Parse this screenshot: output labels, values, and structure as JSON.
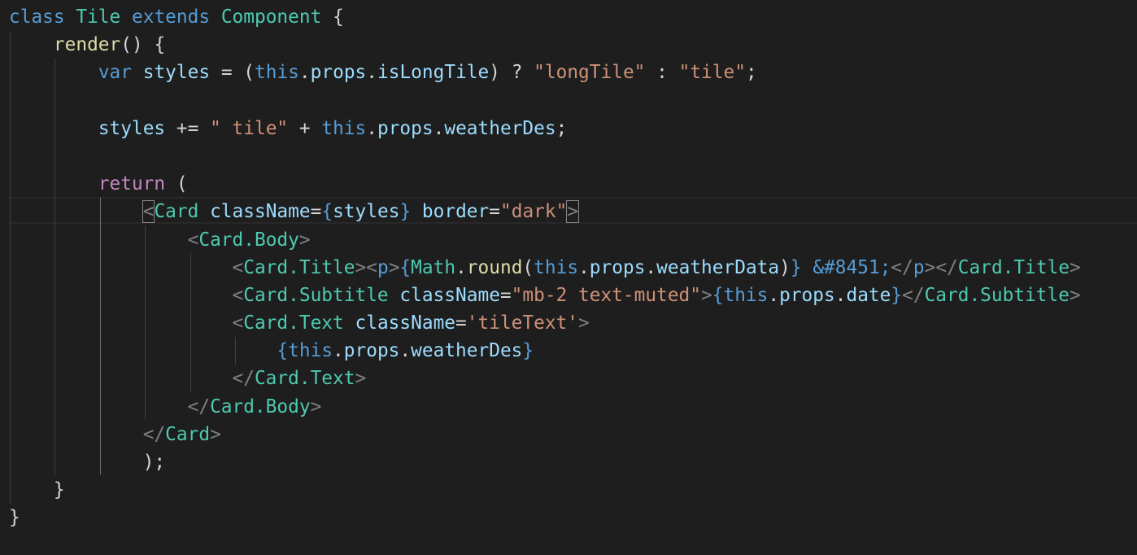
{
  "editor": {
    "theme_colors": {
      "background": "#1e1e1e",
      "keyword_blue": "#569cd6",
      "keyword_purple": "#c586c0",
      "type_teal": "#4ec9b0",
      "function_yellow": "#dcdcaa",
      "variable_lightblue": "#9cdcfe",
      "string_orange": "#ce9178",
      "tag_gray": "#808080",
      "plain": "#d4d4d4"
    },
    "lines": [
      [
        [
          "class",
          "kw"
        ],
        [
          " ",
          "pl"
        ],
        [
          "Tile",
          "ty"
        ],
        [
          " ",
          "pl"
        ],
        [
          "extends",
          "kw"
        ],
        [
          " ",
          "pl"
        ],
        [
          "Component",
          "ty"
        ],
        [
          " {",
          "pl"
        ]
      ],
      [
        [
          "    ",
          "pl"
        ],
        [
          "render",
          "fn"
        ],
        [
          "() {",
          "pl"
        ]
      ],
      [
        [
          "        ",
          "pl"
        ],
        [
          "var",
          "kw"
        ],
        [
          " ",
          "pl"
        ],
        [
          "styles",
          "va"
        ],
        [
          " = (",
          "pl"
        ],
        [
          "this",
          "kw"
        ],
        [
          ".",
          "pl"
        ],
        [
          "props",
          "va"
        ],
        [
          ".",
          "pl"
        ],
        [
          "isLongTile",
          "va"
        ],
        [
          ") ? ",
          "pl"
        ],
        [
          "\"longTile\"",
          "st"
        ],
        [
          " : ",
          "pl"
        ],
        [
          "\"tile\"",
          "st"
        ],
        [
          ";",
          "pl"
        ]
      ],
      [],
      [
        [
          "        ",
          "pl"
        ],
        [
          "styles",
          "va"
        ],
        [
          " += ",
          "pl"
        ],
        [
          "\" tile\"",
          "st"
        ],
        [
          " + ",
          "pl"
        ],
        [
          "this",
          "kw"
        ],
        [
          ".",
          "pl"
        ],
        [
          "props",
          "va"
        ],
        [
          ".",
          "pl"
        ],
        [
          "weatherDes",
          "va"
        ],
        [
          ";",
          "pl"
        ]
      ],
      [],
      [
        [
          "        ",
          "pl"
        ],
        [
          "return",
          "kp"
        ],
        [
          " (",
          "pl"
        ]
      ],
      [
        [
          "            ",
          "pl"
        ],
        [
          "<",
          "tgm"
        ],
        [
          "Card",
          "ty"
        ],
        [
          " ",
          "pl"
        ],
        [
          "className",
          "va"
        ],
        [
          "=",
          "pl"
        ],
        [
          "{",
          "kw"
        ],
        [
          "styles",
          "va"
        ],
        [
          "}",
          "kw"
        ],
        [
          " ",
          "pl"
        ],
        [
          "border",
          "va"
        ],
        [
          "=",
          "pl"
        ],
        [
          "\"dark\"",
          "st"
        ],
        [
          ">",
          "tgm"
        ]
      ],
      [
        [
          "                ",
          "pl"
        ],
        [
          "<",
          "tg"
        ],
        [
          "Card.Body",
          "ty"
        ],
        [
          ">",
          "tg"
        ]
      ],
      [
        [
          "                    ",
          "pl"
        ],
        [
          "<",
          "tg"
        ],
        [
          "Card.Title",
          "ty"
        ],
        [
          ">",
          "tg"
        ],
        [
          "<",
          "tg"
        ],
        [
          "p",
          "kw"
        ],
        [
          ">",
          "tg"
        ],
        [
          "{",
          "kw"
        ],
        [
          "Math",
          "ty"
        ],
        [
          ".",
          "pl"
        ],
        [
          "round",
          "fn"
        ],
        [
          "(",
          "pl"
        ],
        [
          "this",
          "kw"
        ],
        [
          ".",
          "pl"
        ],
        [
          "props",
          "va"
        ],
        [
          ".",
          "pl"
        ],
        [
          "weatherData",
          "va"
        ],
        [
          ")",
          "pl"
        ],
        [
          "}",
          "kw"
        ],
        [
          " ",
          "pl"
        ],
        [
          "&#8451;",
          "kw"
        ],
        [
          "</",
          "tg"
        ],
        [
          "p",
          "kw"
        ],
        [
          ">",
          "tg"
        ],
        [
          "</",
          "tg"
        ],
        [
          "Card.Title",
          "ty"
        ],
        [
          ">",
          "tg"
        ]
      ],
      [
        [
          "                    ",
          "pl"
        ],
        [
          "<",
          "tg"
        ],
        [
          "Card.Subtitle",
          "ty"
        ],
        [
          " ",
          "pl"
        ],
        [
          "className",
          "va"
        ],
        [
          "=",
          "pl"
        ],
        [
          "\"mb-2 text-muted\"",
          "st"
        ],
        [
          ">",
          "tg"
        ],
        [
          "{",
          "kw"
        ],
        [
          "this",
          "kw"
        ],
        [
          ".",
          "pl"
        ],
        [
          "props",
          "va"
        ],
        [
          ".",
          "pl"
        ],
        [
          "date",
          "va"
        ],
        [
          "}",
          "kw"
        ],
        [
          "</",
          "tg"
        ],
        [
          "Card.Subtitle",
          "ty"
        ],
        [
          ">",
          "tg"
        ]
      ],
      [
        [
          "                    ",
          "pl"
        ],
        [
          "<",
          "tg"
        ],
        [
          "Card.Text",
          "ty"
        ],
        [
          " ",
          "pl"
        ],
        [
          "className",
          "va"
        ],
        [
          "=",
          "pl"
        ],
        [
          "'tileText'",
          "st"
        ],
        [
          ">",
          "tg"
        ]
      ],
      [
        [
          "                        ",
          "pl"
        ],
        [
          "{",
          "kw"
        ],
        [
          "this",
          "kw"
        ],
        [
          ".",
          "pl"
        ],
        [
          "props",
          "va"
        ],
        [
          ".",
          "pl"
        ],
        [
          "weatherDes",
          "va"
        ],
        [
          "}",
          "kw"
        ]
      ],
      [
        [
          "                    ",
          "pl"
        ],
        [
          "</",
          "tg"
        ],
        [
          "Card.Text",
          "ty"
        ],
        [
          ">",
          "tg"
        ]
      ],
      [
        [
          "                ",
          "pl"
        ],
        [
          "</",
          "tg"
        ],
        [
          "Card.Body",
          "ty"
        ],
        [
          ">",
          "tg"
        ]
      ],
      [
        [
          "            ",
          "pl"
        ],
        [
          "</",
          "tg"
        ],
        [
          "Card",
          "ty"
        ],
        [
          ">",
          "tg"
        ]
      ],
      [
        [
          "            );",
          "pl"
        ]
      ],
      [
        [
          "    }",
          "pl"
        ]
      ],
      [
        [
          "}",
          "pl"
        ]
      ]
    ]
  }
}
